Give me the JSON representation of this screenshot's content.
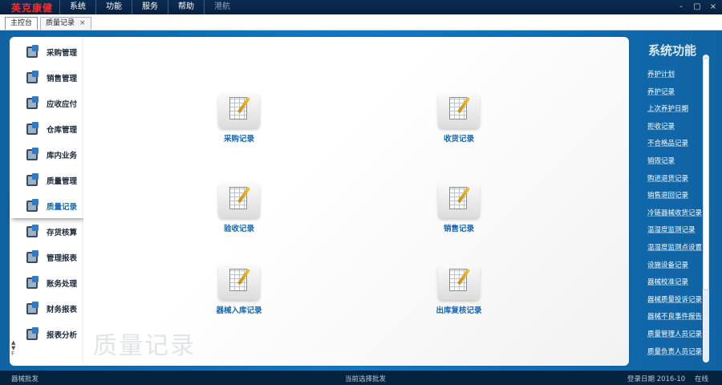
{
  "app": {
    "brand": "英克康健"
  },
  "menu": [
    {
      "label": "系统"
    },
    {
      "label": "功能"
    },
    {
      "label": "服务"
    },
    {
      "label": "帮助"
    },
    {
      "label": "港航"
    }
  ],
  "window_controls": [
    "-",
    "▢",
    "×"
  ],
  "tabs": [
    {
      "label": "主控台"
    },
    {
      "label": "质量记录"
    }
  ],
  "tab_close": "×",
  "nav": [
    {
      "label": "采购管理",
      "icon": "purchase-icon"
    },
    {
      "label": "销售管理",
      "icon": "sales-icon"
    },
    {
      "label": "应收应付",
      "icon": "payables-icon"
    },
    {
      "label": "仓库管理",
      "icon": "warehouse-icon"
    },
    {
      "label": "库内业务",
      "icon": "inventory-icon"
    },
    {
      "label": "质量管理",
      "icon": "quality-icon"
    },
    {
      "label": "质量记录",
      "icon": "quality-record-icon"
    },
    {
      "label": "存货核算",
      "icon": "stock-accounting-icon"
    },
    {
      "label": "管理报表",
      "icon": "management-report-icon"
    },
    {
      "label": "账务处理",
      "icon": "accounting-icon"
    },
    {
      "label": "财务报表",
      "icon": "finance-report-icon"
    },
    {
      "label": "报表分析",
      "icon": "report-analysis-icon"
    }
  ],
  "nav_scroll": {
    "up": "▲",
    "down": "▼",
    "more": "F"
  },
  "tiles": [
    {
      "label": "采购记录",
      "icon": "document-edit-icon"
    },
    {
      "label": "收货记录",
      "icon": "document-edit-icon"
    },
    {
      "label": "验收记录",
      "icon": "document-edit-icon"
    },
    {
      "label": "销售记录",
      "icon": "document-edit-icon"
    },
    {
      "label": "器械入库记录",
      "icon": "document-edit-icon"
    },
    {
      "label": "出库复核记录",
      "icon": "document-edit-icon"
    }
  ],
  "watermark": "质量记录",
  "functions": {
    "title": "系统功能",
    "items": [
      "养护计划",
      "养护记录",
      "上次养护日期",
      "拒收记录",
      "不合格品记录",
      "销毁记录",
      "购进退货记录",
      "销售退回记录",
      "冷链器械收货记录",
      "温湿度监测记录",
      "温湿度监测点设置",
      "设施设备记录",
      "器械校准记录",
      "器械质量投诉记录",
      "器械不良事件报告",
      "质量管理人员记录",
      "质量负责人员记录"
    ]
  },
  "status": {
    "left": "器械批发",
    "center": "当前选择批发",
    "date": "登录日期 2016-10",
    "right": "在线"
  },
  "colors": {
    "brand": "#ff2b2b",
    "accent": "#1565b3",
    "workspace": "#1677bf"
  }
}
